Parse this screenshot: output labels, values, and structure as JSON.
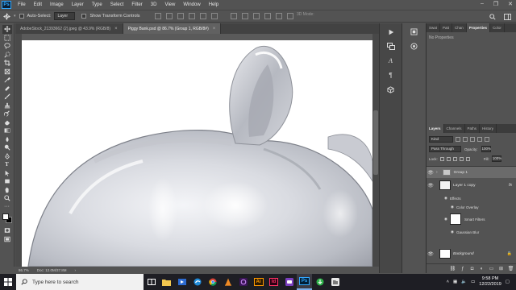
{
  "app": {
    "logo": "Ps"
  },
  "menubar": {
    "items": [
      "File",
      "Edit",
      "Image",
      "Layer",
      "Type",
      "Select",
      "Filter",
      "3D",
      "View",
      "Window",
      "Help"
    ]
  },
  "window_controls": {
    "minimize": "–",
    "restore": "❐",
    "close": "✕"
  },
  "options": {
    "auto_select_label": "Auto-Select:",
    "auto_select_value": "Layer",
    "transform_label": "Show Transform Controls",
    "mode_3d": "3D Mode:"
  },
  "tabs": [
    {
      "label": "AdobeStock_21393662 (2).jpeg @ 43.9% (RGB/8)",
      "close": "×"
    },
    {
      "label": "Piggy Bank.psd @ 86.7% (Group 1, RGB/8#)",
      "close": "×"
    }
  ],
  "status": {
    "zoom": "86.7%",
    "doc": "Doc: 12.0M/37.8M"
  },
  "panel_top": {
    "tabs": [
      "Swat",
      "Patt",
      "Chan",
      "Properties",
      "Color"
    ],
    "body": "No Properties"
  },
  "layers_panel": {
    "tabs": [
      "Layers",
      "Channels",
      "Paths",
      "History"
    ],
    "kind": "Kind",
    "blend_mode": "Pass Through",
    "opacity_label": "Opacity:",
    "opacity": "100%",
    "lock_label": "Lock:",
    "fill_label": "Fill:",
    "fill": "100%",
    "layers": [
      {
        "name": "Group 1"
      },
      {
        "name": "Layer 1 copy",
        "fx": "fx"
      },
      {
        "name": "Background"
      }
    ],
    "sublayers": [
      "Effects",
      "Color Overlay",
      "Smart Filters",
      "Gaussian Blur"
    ]
  },
  "taskbar": {
    "search_placeholder": "Type here to search",
    "apps": [
      "Ai",
      "Id",
      "Ps"
    ],
    "time": "9:58 PM",
    "date": "12/22/2019"
  },
  "colors": {
    "accent": "#31a8ff",
    "ui": "#535353",
    "panel_dark": "#3c3c3c",
    "taskbar": "#1e1e24"
  }
}
